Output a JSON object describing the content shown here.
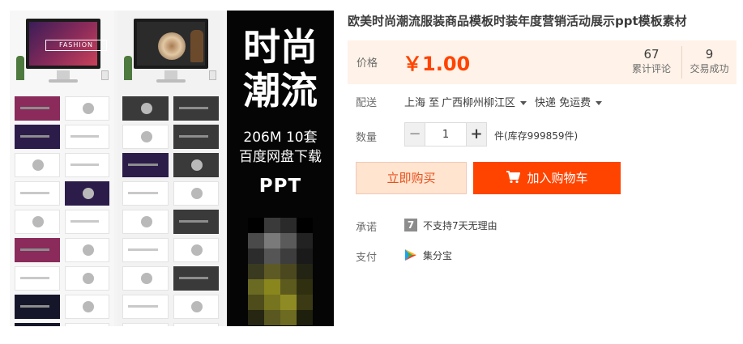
{
  "product": {
    "title": "欧美时尚潮流服装商品模板时装年度营销活动展示ppt模板素材"
  },
  "gallery": {
    "monitor_label": "FASHION",
    "poster_line1": "时尚",
    "poster_line2": "潮流",
    "poster_line3": "206M   10套",
    "poster_line4": "百度网盘下载",
    "poster_line5": "PPT",
    "poster_bg_color": "#050505"
  },
  "price": {
    "label": "价格",
    "value": "￥1.00",
    "color": "#ff4400"
  },
  "stats": [
    {
      "number": "67",
      "label": "累计评论"
    },
    {
      "number": "9",
      "label": "交易成功"
    }
  ],
  "shipping": {
    "label": "配送",
    "from": "上海 至",
    "to": "广西柳州柳江区",
    "method": "快递 免运费"
  },
  "quantity": {
    "label": "数量",
    "minus": "−",
    "value": "1",
    "plus": "+",
    "stock": "件(库存999859件)"
  },
  "actions": {
    "buy_now": "立即购买",
    "add_to_cart": "加入购物车",
    "accent_color": "#ff4400"
  },
  "promise": {
    "label": "承诺",
    "icon": "7",
    "text": "不支持7天无理由"
  },
  "payment": {
    "label": "支付",
    "icon": "jifenbao-icon",
    "text": "集分宝"
  }
}
